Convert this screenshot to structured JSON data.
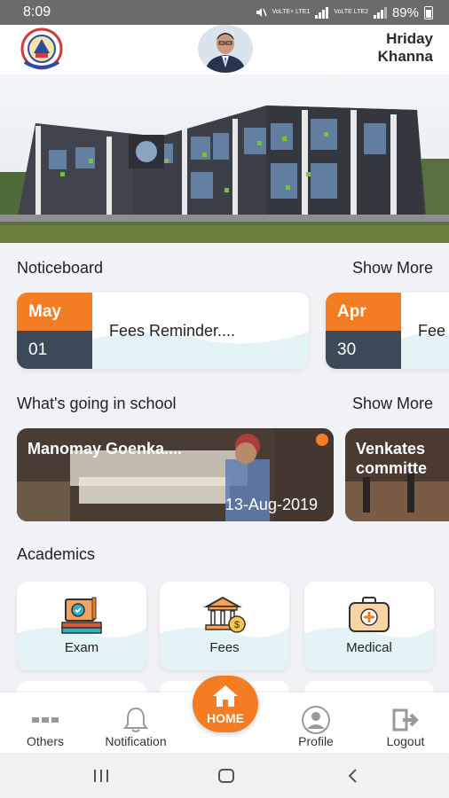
{
  "status_bar": {
    "time": "8:09",
    "sim1_label": "VoLTE+ LTE1",
    "sim2_label": "VoLTE LTE2",
    "battery": "89%"
  },
  "header": {
    "user_name_line1": "Hriday",
    "user_name_line2": "Khanna",
    "logo_icon": "school-crest-icon",
    "avatar_icon": "user-photo"
  },
  "noticeboard": {
    "title": "Noticeboard",
    "show_more": "Show More",
    "items": [
      {
        "month": "May",
        "day": "01",
        "text": "Fees Reminder...."
      },
      {
        "month": "Apr",
        "day": "30",
        "text": "Fee"
      }
    ]
  },
  "events": {
    "title": "What's going in school",
    "show_more": "Show More",
    "items": [
      {
        "title": "Manomay Goenka....",
        "date": "13-Aug-2019"
      },
      {
        "title": "Venkates committe",
        "date": ""
      }
    ]
  },
  "academics": {
    "title": "Academics",
    "items": [
      {
        "label": "Exam",
        "icon": "exam-icon"
      },
      {
        "label": "Fees",
        "icon": "fees-icon"
      },
      {
        "label": "Medical",
        "icon": "medical-icon"
      }
    ]
  },
  "bottom_nav": {
    "others": "Others",
    "notification": "Notification",
    "home": "HOME",
    "profile": "Profile",
    "logout": "Logout"
  },
  "colors": {
    "accent": "#f47c22",
    "dark": "#3c4a57",
    "wave": "#e4f4f6"
  }
}
